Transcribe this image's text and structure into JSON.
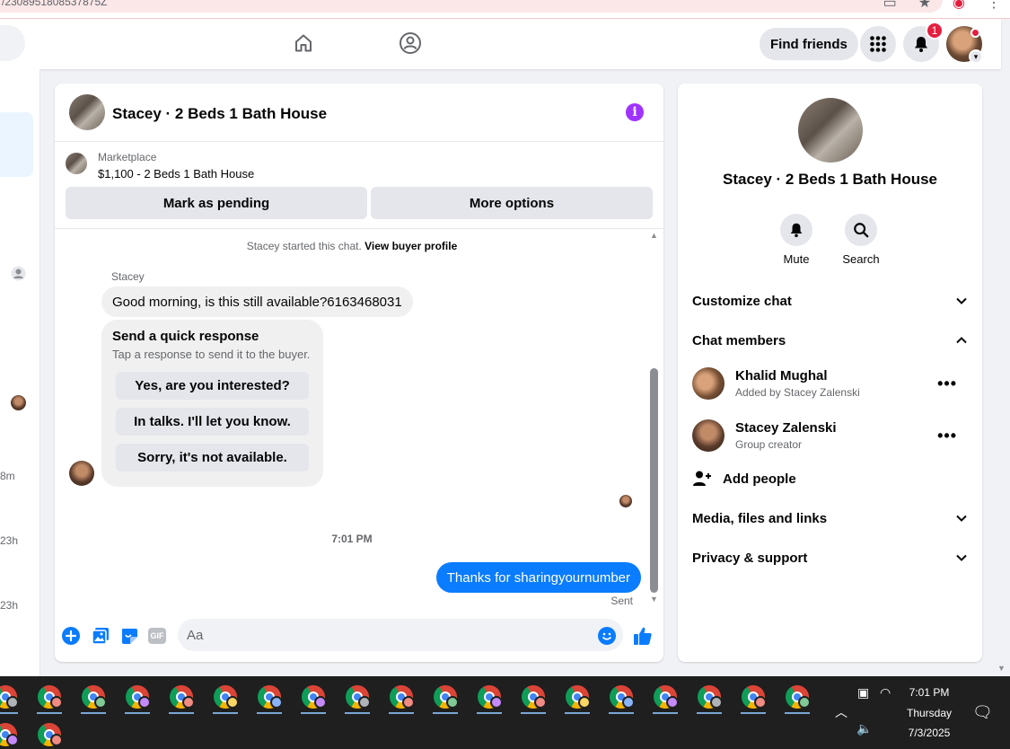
{
  "browser": {
    "url_fragment": "/2308951808537875Z"
  },
  "header": {
    "find_friends_label": "Find friends",
    "notification_count": "1"
  },
  "left_rail": {
    "times": [
      "8m",
      "23h",
      "23h"
    ]
  },
  "chat": {
    "title": "Stacey · 2 Beds 1 Bath House",
    "marketplace_label": "Marketplace",
    "listing_title": "$1,100 - 2 Beds 1 Bath House",
    "mark_pending_label": "Mark as pending",
    "more_options_label": "More options",
    "started_text": "Stacey started this chat.",
    "view_profile_link": "View buyer profile",
    "sender_name": "Stacey",
    "incoming_message": "Good morning, is this still available?6163468031",
    "quick_response": {
      "title": "Send a quick response",
      "subtitle": "Tap a response to send it to the buyer.",
      "options": [
        "Yes, are you interested?",
        "In talks. I'll let you know.",
        "Sorry, it's not available."
      ]
    },
    "timestamp": "7:01 PM",
    "outgoing_message": "Thanks for sharingyournumber",
    "sent_status": "Sent",
    "composer_placeholder": "Aa",
    "gif_label": "GIF"
  },
  "info_panel": {
    "title": "Stacey · 2 Beds 1 Bath House",
    "mute_label": "Mute",
    "search_label": "Search",
    "customize_chat_label": "Customize chat",
    "chat_members_label": "Chat members",
    "members": [
      {
        "name": "Khalid Mughal",
        "subtitle": "Added by Stacey Zalenski"
      },
      {
        "name": "Stacey Zalenski",
        "subtitle": "Group creator"
      }
    ],
    "add_people_label": "Add people",
    "media_label": "Media, files and links",
    "privacy_label": "Privacy & support"
  },
  "taskbar": {
    "time": "7:01 PM",
    "day": "Thursday",
    "date": "7/3/2025"
  },
  "colors": {
    "messenger_blue": "#0a7cff",
    "info_purple": "#a033ff",
    "notification_red": "#e41e3f"
  }
}
